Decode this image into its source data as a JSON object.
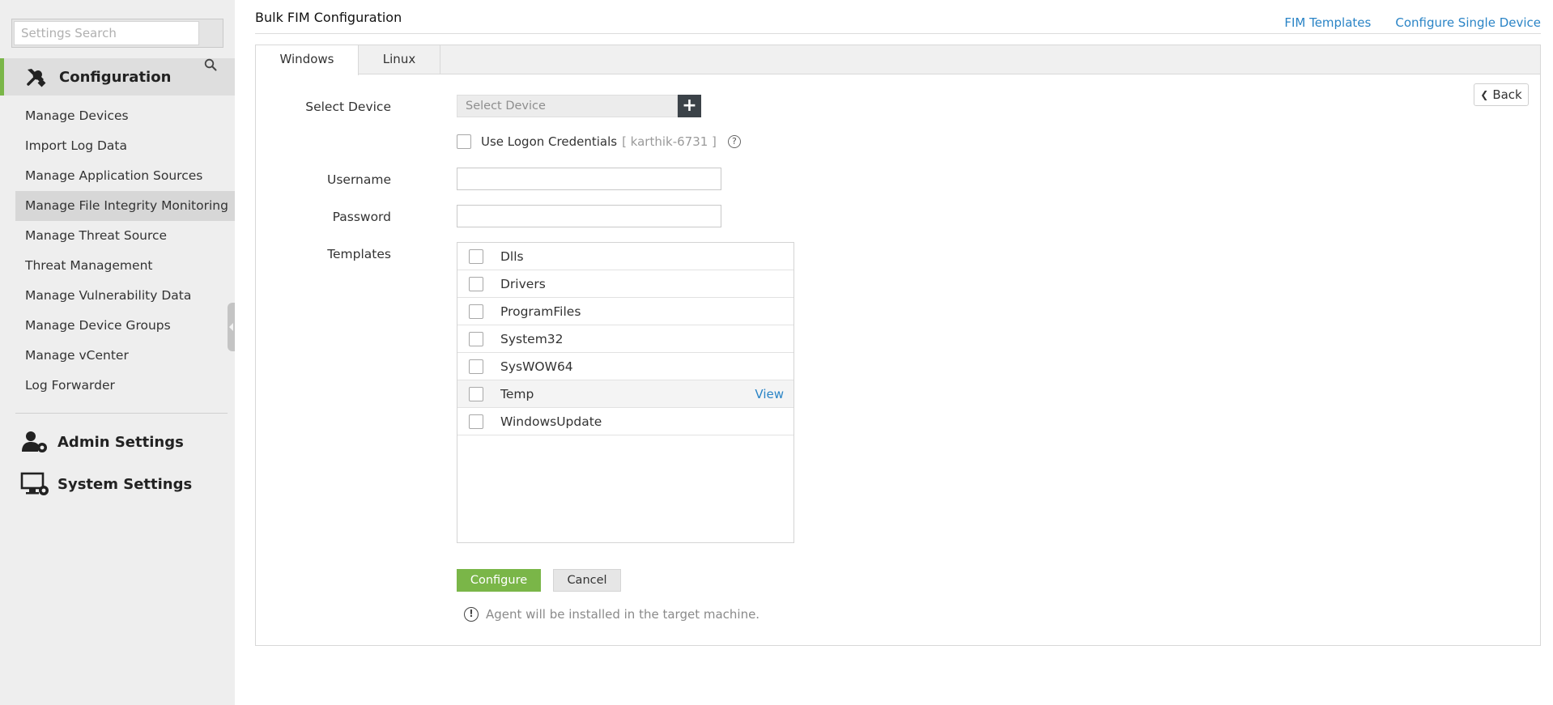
{
  "sidebar": {
    "search_placeholder": "Settings Search",
    "configuration_title": "Configuration",
    "items": [
      {
        "label": "Manage Devices"
      },
      {
        "label": "Import Log Data"
      },
      {
        "label": "Manage Application Sources"
      },
      {
        "label": "Manage File Integrity Monitoring",
        "active": true
      },
      {
        "label": "Manage Threat Source"
      },
      {
        "label": "Threat Management"
      },
      {
        "label": "Manage Vulnerability Data"
      },
      {
        "label": "Manage Device Groups"
      },
      {
        "label": "Manage vCenter"
      },
      {
        "label": "Log Forwarder"
      }
    ],
    "admin_settings": "Admin Settings",
    "system_settings": "System Settings"
  },
  "header": {
    "title": "Bulk FIM Configuration",
    "links": {
      "fim_templates": "FIM Templates",
      "configure_single_device": "Configure Single Device"
    }
  },
  "tabs": {
    "windows": "Windows",
    "linux": "Linux",
    "active": "Windows"
  },
  "back_label": "Back",
  "form": {
    "select_device_label": "Select Device",
    "select_device_placeholder": "Select Device",
    "add_symbol": "+",
    "use_logon_label": "Use Logon Credentials",
    "logon_credential": "[ karthik-6731 ]",
    "help_symbol": "?",
    "username_label": "Username",
    "username_value": "",
    "password_label": "Password",
    "password_value": "",
    "templates_label": "Templates",
    "templates": [
      {
        "name": "Dlls"
      },
      {
        "name": "Drivers"
      },
      {
        "name": "ProgramFiles"
      },
      {
        "name": "System32"
      },
      {
        "name": "SysWOW64"
      },
      {
        "name": "Temp",
        "view": "View"
      },
      {
        "name": "WindowsUpdate"
      }
    ]
  },
  "buttons": {
    "configure": "Configure",
    "cancel": "Cancel"
  },
  "note": {
    "icon": "!",
    "text": "Agent will be installed in the target machine."
  },
  "colors": {
    "accent_green": "#7ab648",
    "link_blue": "#2a84c6",
    "dark_button": "#3b4248"
  }
}
